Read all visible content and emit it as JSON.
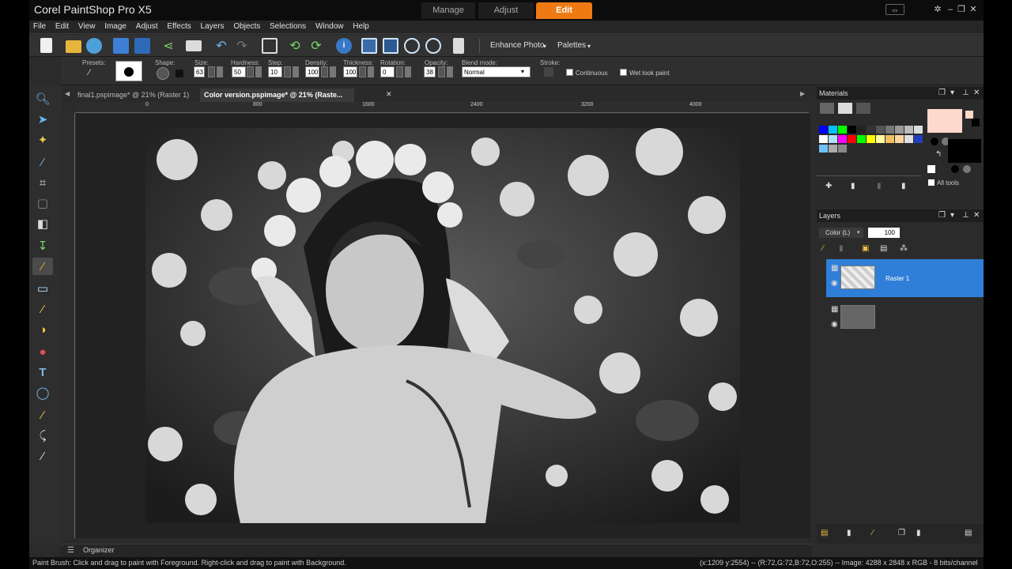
{
  "app": {
    "title": "Corel PaintShop Pro X5",
    "workspace_tabs": [
      {
        "label": "Manage"
      },
      {
        "label": "Adjust"
      },
      {
        "label": "Edit"
      }
    ]
  },
  "menu": [
    "File",
    "Edit",
    "View",
    "Image",
    "Adjust",
    "Effects",
    "Layers",
    "Objects",
    "Selections",
    "Window",
    "Help"
  ],
  "toolbar": {
    "enhance_photo": "Enhance Photo",
    "palettes": "Palettes"
  },
  "options": {
    "presets_label": "Presets:",
    "shape_label": "Shape:",
    "size_label": "Size:",
    "size_value": "63",
    "hardness_label": "Hardness:",
    "hardness_value": "50",
    "step_label": "Step:",
    "step_value": "10",
    "density_label": "Density:",
    "density_value": "100",
    "thickness_label": "Thickness:",
    "thickness_value": "100",
    "rotation_label": "Rotation:",
    "rotation_value": "0",
    "opacity_label": "Opacity:",
    "opacity_value": "38",
    "blend_label": "Blend mode:",
    "blend_value": "Normal",
    "stroke_label": "Stroke:",
    "continuous_label": "Continuous",
    "wetlook_label": "Wet look paint"
  },
  "documents": {
    "tabs": [
      {
        "label": "final1.pspimage* @  21% (Raster 1)"
      },
      {
        "label": "Color version.pspimage* @  21% (Raste..."
      }
    ]
  },
  "ruler": {
    "h_labels": [
      "0",
      "800",
      "1600",
      "2400",
      "3200",
      "4000"
    ]
  },
  "materials": {
    "title": "Materials",
    "all_tools": "All tools",
    "foreground_color": "#ffd8cc",
    "background_color": "#000000"
  },
  "layers": {
    "title": "Layers",
    "mode": "Color (L)",
    "opacity": "100",
    "items": [
      {
        "name": "Raster 1"
      },
      {
        "name": ""
      }
    ]
  },
  "organizer": {
    "label": "Organizer"
  },
  "status": {
    "hint": "Paint Brush: Click and drag to paint with Foreground. Right-click and drag to paint with Background.",
    "info": "(x:1209 y:2554) -- (R:72,G:72,B:72,O:255) -- Image:  4288 x 2848 x RGB - 8 bits/channel"
  },
  "colors": {
    "accent": "#ef7a14",
    "selection": "#2f7fd8"
  }
}
